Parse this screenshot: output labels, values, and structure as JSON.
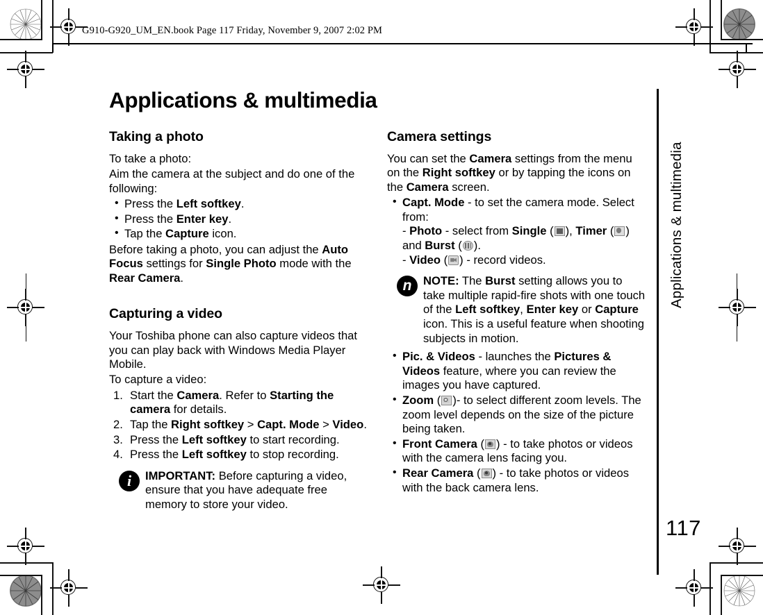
{
  "print_header": {
    "text": "G910-G920_UM_EN.book  Page 117  Friday, November 9, 2007  2:02 PM"
  },
  "page": {
    "title": "Applications & multimedia",
    "running_head": "Applications & multimedia",
    "number": "117"
  },
  "left_column": {
    "section1": {
      "heading": "Taking a photo",
      "intro1": "To take a photo:",
      "intro2": "Aim the camera at the subject and do one of the following:",
      "bullets": [
        {
          "pre": "Press the ",
          "bold": "Left softkey",
          "post": "."
        },
        {
          "pre": "Press the ",
          "bold": "Enter key",
          "post": "."
        },
        {
          "pre": "Tap the ",
          "bold": "Capture",
          "post": " icon."
        }
      ],
      "closing": {
        "p1": "Before taking a photo, you can adjust the ",
        "b1": "Auto Focus",
        "p2": " settings for ",
        "b2": "Single Photo",
        "p3": " mode with the ",
        "b3": "Rear Camera",
        "p4": "."
      }
    },
    "section2": {
      "heading": "Capturing a video",
      "intro1": "Your Toshiba phone can also capture videos that you can play back with Windows Media Player Mobile.",
      "intro2": "To capture a video:",
      "steps": [
        {
          "p1": "Start the ",
          "b1": "Camera",
          "p2": ". Refer to ",
          "b2": "Starting the camera",
          "p3": " for details."
        },
        {
          "p1": "Tap the ",
          "b1": "Right softkey",
          "p2": " > ",
          "b2": "Capt. Mode",
          "p3": " > ",
          "b3": "Video",
          "p4": "."
        },
        {
          "p1": "Press the ",
          "b1": "Left softkey",
          "p2": " to start recording."
        },
        {
          "p1": "Press the ",
          "b1": "Left softkey",
          "p2": " to stop recording."
        }
      ],
      "callout": {
        "badge": "i",
        "badge_icon": "info-icon",
        "label": "IMPORTANT:",
        "text": " Before capturing a video, ensure that you have adequate free memory to store your video."
      }
    }
  },
  "right_column": {
    "heading": "Camera settings",
    "intro": {
      "p1": "You can set the ",
      "b1": "Camera",
      "p2": " settings from the menu on the ",
      "b2": "Right softkey",
      "p3": " or by tapping the icons on the ",
      "b3": "Camera",
      "p4": " screen."
    },
    "capt_mode": {
      "bold": "Capt. Mode",
      "text": " - to set the camera mode. Select from:",
      "photo": {
        "dash": "- ",
        "b1": "Photo",
        "t1": " - select from ",
        "b2": "Single",
        "icon1": "single-photo-icon",
        "t2": ", ",
        "b3": "Timer",
        "icon2": "timer-icon",
        "t3": " and ",
        "b4": "Burst",
        "icon3": "burst-icon",
        "t4": "."
      },
      "video": {
        "dash": "- ",
        "b1": "Video",
        "icon": "video-icon",
        "t1": " - record videos."
      }
    },
    "callout": {
      "badge": "n",
      "badge_icon": "note-icon",
      "label": "NOTE:",
      "p1": " The ",
      "b1": "Burst",
      "p2": " setting allows you to take multiple rapid-fire shots with one touch of the ",
      "b2": "Left softkey",
      "p3": ", ",
      "b3": "Enter key",
      "p4": " or ",
      "b4": "Capture",
      "p5": " icon. This is a useful feature when shooting subjects in motion."
    },
    "bullets": [
      {
        "b1": "Pic. & Videos",
        "t1": " - launches the ",
        "b2": "Pictures & Videos",
        "t2": " feature, where you can review the images you have captured."
      },
      {
        "b1": "Zoom",
        "icon": "zoom-icon",
        "t1": "- to select different zoom levels. The zoom level depends on the size of the picture being taken."
      },
      {
        "b1": "Front Camera",
        "icon": "front-camera-icon",
        "t1": " - to take photos or videos with the camera lens facing you."
      },
      {
        "b1": "Rear Camera",
        "icon": "rear-camera-icon",
        "t1": " - to take photos or videos with the back camera lens."
      }
    ]
  },
  "colors": {
    "ink": "#000000",
    "paper": "#ffffff",
    "icon_gray": "#8d8d8d"
  }
}
